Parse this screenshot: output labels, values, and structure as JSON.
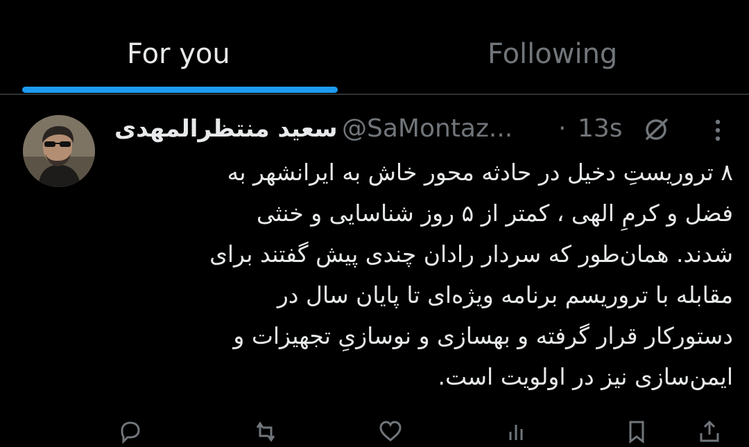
{
  "tabs": [
    {
      "label": "For you",
      "active": true
    },
    {
      "label": "Following",
      "active": false
    }
  ],
  "tweet": {
    "display_name": "سعید منتظرالمهدی",
    "handle": "@SaMontaz...",
    "separator": "·",
    "time": "13s",
    "body": "۸ تروریستِ دخیل در حادثه محور خاش به ایرانشهر به\nفضل و کرمِ الهی ، کمتر از ۵ روز شناسایی و خنثی\nشدند. همان‌طور که سردار رادان چندی پیش گفتند برای\nمقابله با تروریسم برنامه ویژه‌ای تا پایان سال در\nدستورکار قرار گرفته و بهسازی و نوسازیِ تجهیزات و\nایمن‌سازی نیز در اولویت است."
  },
  "icons": {
    "grok": "grok-icon",
    "more": "more-icon",
    "reply": "reply-icon",
    "retweet": "retweet-icon",
    "like": "like-icon",
    "views": "views-icon",
    "bookmark": "bookmark-icon",
    "share": "share-icon"
  },
  "colors": {
    "background": "#000000",
    "accent": "#1d9bf0",
    "primary_text": "#e7e9ea",
    "secondary_text": "#71767b",
    "divider": "#2f3336"
  }
}
